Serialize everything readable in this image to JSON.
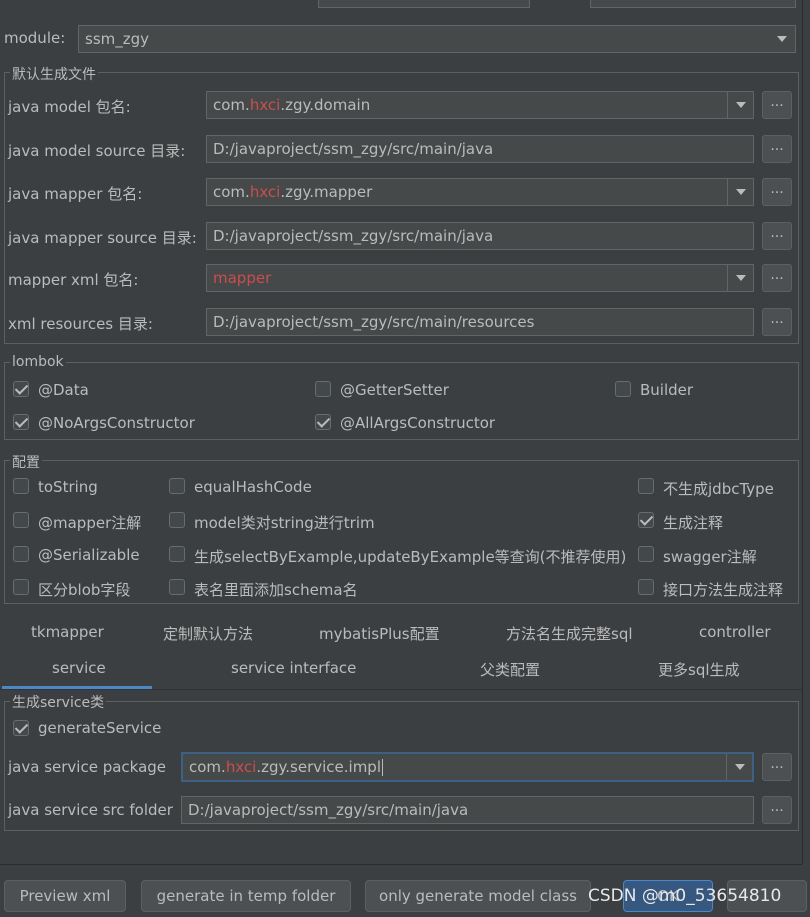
{
  "module": {
    "label": "module:",
    "value": "ssm_zgy"
  },
  "default_files": {
    "title": "默认生成文件",
    "rows": [
      {
        "label": "java model 包名:",
        "prefix": "com.",
        "red": "hxci",
        "suffix": ".zgy.domain"
      },
      {
        "label": "java model source 目录:",
        "value": "D:/javaproject/ssm_zgy/src/main/java"
      },
      {
        "label": "java mapper 包名:",
        "prefix": "com.",
        "red": "hxci",
        "suffix": ".zgy.mapper"
      },
      {
        "label": "java mapper source 目录:",
        "value": "D:/javaproject/ssm_zgy/src/main/java"
      },
      {
        "label": "mapper xml 包名:",
        "red": "mapper"
      },
      {
        "label": "xml resources 目录:",
        "value": "D:/javaproject/ssm_zgy/src/main/resources"
      }
    ],
    "browse": "..."
  },
  "lombok": {
    "title": "lombok",
    "items": [
      {
        "label": "@Data",
        "checked": true
      },
      {
        "label": "@GetterSetter",
        "checked": false
      },
      {
        "label": "Builder",
        "checked": false
      },
      {
        "label": "@NoArgsConstructor",
        "checked": true
      },
      {
        "label": "@AllArgsConstructor",
        "checked": true
      }
    ]
  },
  "config": {
    "title": "配置",
    "items": [
      {
        "label": "toString",
        "checked": false
      },
      {
        "label": "equalHashCode",
        "checked": false
      },
      {
        "label": "不生成jdbcType",
        "checked": false
      },
      {
        "label": "@mapper注解",
        "checked": false
      },
      {
        "label": "model类对string进行trim",
        "checked": false
      },
      {
        "label": "生成注释",
        "checked": true
      },
      {
        "label": "@Serializable",
        "checked": false
      },
      {
        "label": "生成selectByExample,updateByExample等查询(不推荐使用)",
        "checked": false
      },
      {
        "label": "swagger注解",
        "checked": false
      },
      {
        "label": "区分blob字段",
        "checked": false
      },
      {
        "label": "表名里面添加schema名",
        "checked": false
      },
      {
        "label": "接口方法生成注释",
        "checked": false
      }
    ]
  },
  "tabs_row1": [
    "tkmapper",
    "定制默认方法",
    "mybatisPlus配置",
    "方法名生成完整sql",
    "controller"
  ],
  "tabs_row2": [
    "service",
    "service interface",
    "父类配置",
    "更多sql生成"
  ],
  "service": {
    "title": "生成service类",
    "generate_label": "generateService",
    "generate_checked": true,
    "package_label": "java service package",
    "package_prefix": "com.",
    "package_red": "hxci",
    "package_suffix": ".zgy.service.impl",
    "folder_label": "java service src folder",
    "folder_value": "D:/javaproject/ssm_zgy/src/main/java"
  },
  "buttons": {
    "preview": "Preview xml",
    "temp": "generate in temp folder",
    "model_only": "only generate model class",
    "ok": "OK"
  },
  "watermark": "CSDN @m0_53654810",
  "colors": {
    "accent": "#4a88c7",
    "red_text": "#cc4d4d",
    "background": "#3c3f41"
  }
}
